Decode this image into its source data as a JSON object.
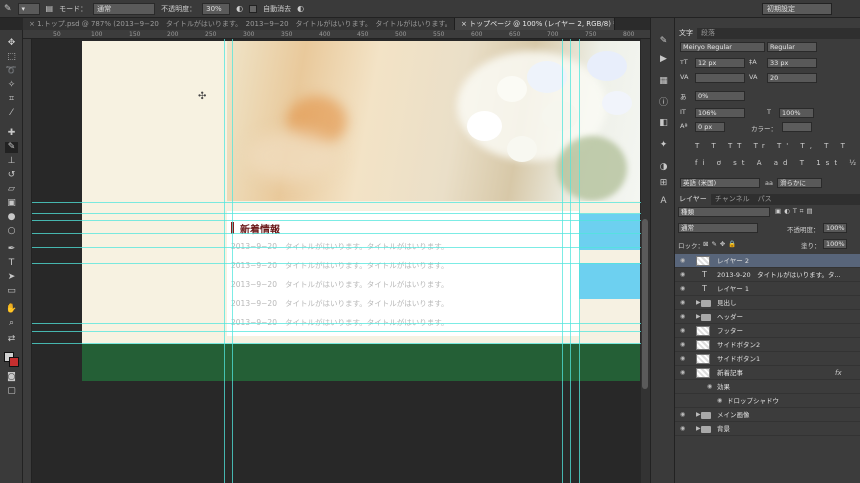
{
  "options_bar": {
    "mode_label": "モード：",
    "mode_value": "通常",
    "opacity_label": "不透明度：",
    "opacity_value": "30%",
    "auto_erase_label": "自動消去",
    "workspace": "初期設定"
  },
  "tabs": [
    {
      "label": "× 1.トップ.psd @ 787% (2013−9−20　タイトルがはいります。　2013−9−20　タイトルがはいります。　タイトルがはいります。"
    },
    {
      "label": "× トップページ @ 100% (レイヤー 2, RGB/8) *"
    }
  ],
  "ruler_ticks": [
    "50",
    "100",
    "150",
    "200",
    "250",
    "300",
    "350",
    "400",
    "450",
    "500",
    "550",
    "600",
    "650",
    "700",
    "750",
    "800"
  ],
  "document": {
    "news_title": "新着情報",
    "news_items": [
      {
        "date": "2013−9−20",
        "title": "タイトルがはいります。タイトルがはいります。"
      },
      {
        "date": "2013−9−20",
        "title": "タイトルがはいります。タイトルがはいります。"
      },
      {
        "date": "2013−9−20",
        "title": "タイトルがはいります。タイトルがはいります。"
      },
      {
        "date": "2013−9−20",
        "title": "タイトルがはいります。タイトルがはいります。"
      },
      {
        "date": "2013−9−20",
        "title": "タイトルがはいります。タイトルがはいります。"
      }
    ]
  },
  "character_panel": {
    "tabs": [
      "文字",
      "段落"
    ],
    "font_family": "Meiryo Regular",
    "font_style": "Regular",
    "font_size": "12 px",
    "leading": "33 px",
    "tracking": "20",
    "kerning_pct": "0%",
    "vertical_scale": "106%",
    "horizontal_scale": "100%",
    "baseline_shift": "0 px",
    "color_label": "カラー：",
    "style_buttons": "T T TT Tr T' T, T T",
    "opentype_buttons": "fi ơ st A ad T 1st ½",
    "language": "英語 (米国)",
    "aa_label": "aa",
    "antialias": "滑らかに"
  },
  "layers_panel": {
    "tabs": [
      "レイヤー",
      "チャンネル",
      "パス"
    ],
    "filter": "種類",
    "blend_mode": "通常",
    "opacity_label": "不透明度：",
    "opacity_value": "100%",
    "lock_label": "ロック：",
    "fill_label": "塗り：",
    "fill_value": "100%",
    "layers": [
      {
        "name": "レイヤー 2",
        "kind": "pixel",
        "selected": true
      },
      {
        "name": "2013-9-20　タイトルがはいります。タ...",
        "kind": "text",
        "selected": false
      },
      {
        "name": "レイヤー 1",
        "kind": "text",
        "selected": false
      },
      {
        "name": "見出し",
        "kind": "folder",
        "selected": false
      },
      {
        "name": "ヘッダー",
        "kind": "folder",
        "selected": false
      },
      {
        "name": "フッター",
        "kind": "pixel",
        "selected": false
      },
      {
        "name": "サイドボタン2",
        "kind": "pixel",
        "selected": false
      },
      {
        "name": "サイドボタン1",
        "kind": "pixel",
        "selected": false
      },
      {
        "name": "新着記事",
        "kind": "pixel",
        "selected": false,
        "fx": "fx"
      },
      {
        "name": "効果",
        "kind": "effect",
        "selected": false
      },
      {
        "name": "ドロップシャドウ",
        "kind": "effect-item",
        "selected": false
      },
      {
        "name": "メイン画像",
        "kind": "folder",
        "selected": false
      },
      {
        "name": "背景",
        "kind": "folder",
        "selected": false
      }
    ]
  },
  "colors": {
    "accent_red": "#8a1c1c",
    "footer_green": "#245f36",
    "side_button_blue": "#6dd0f0",
    "guide_cyan": "#50e6dc",
    "layer_selected": "#58657a"
  }
}
